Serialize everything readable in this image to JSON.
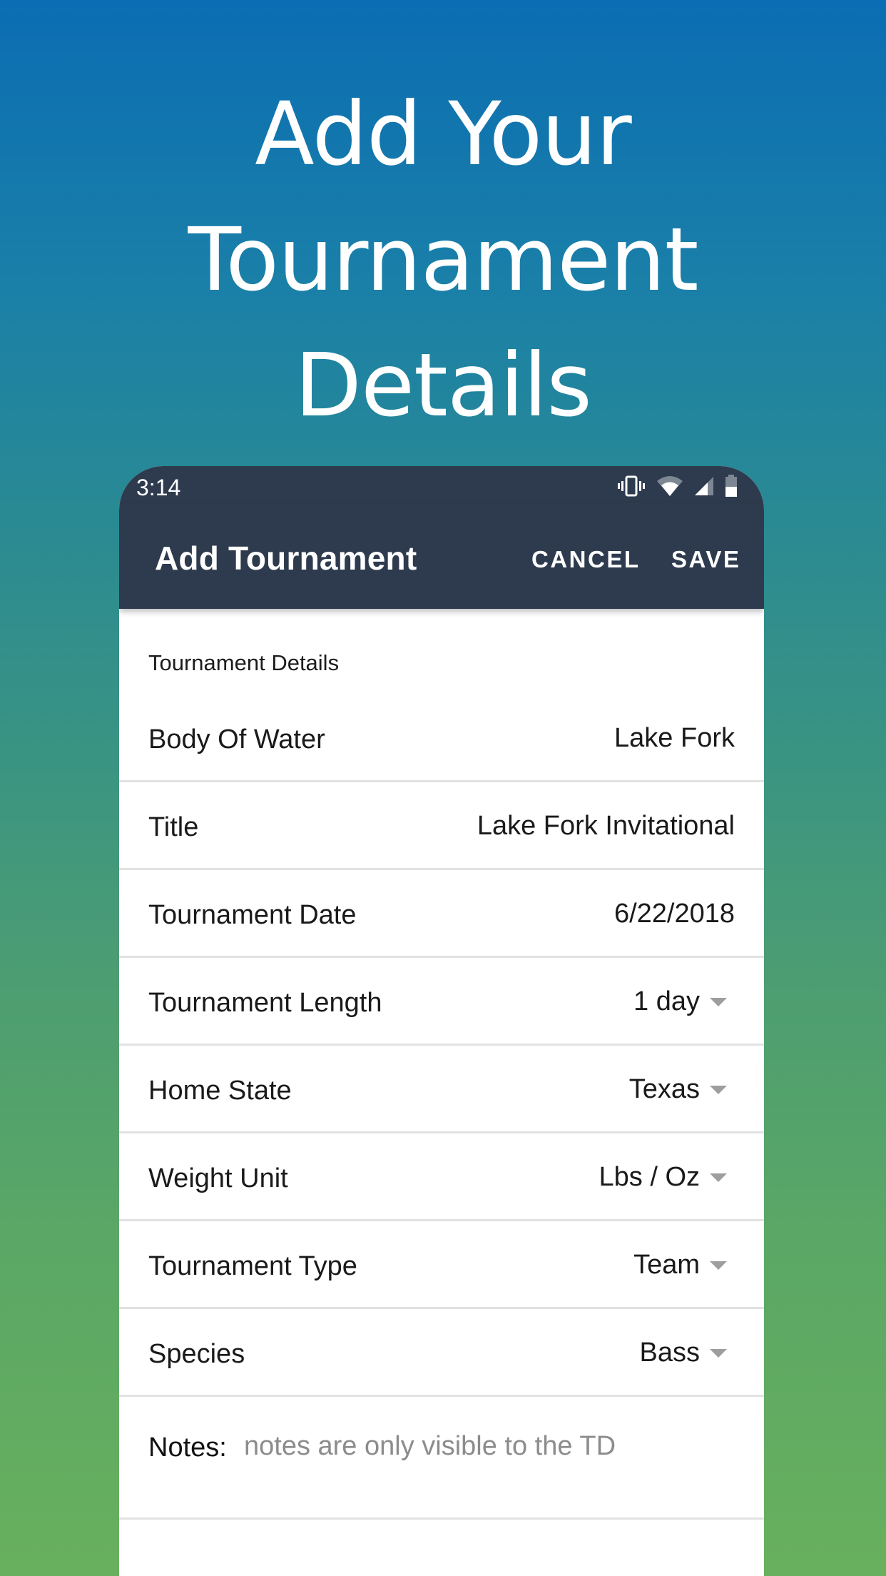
{
  "promo": {
    "headline_lines": [
      "Add Your",
      "Tournament",
      "Details"
    ]
  },
  "status_bar": {
    "time": "3:14",
    "icons": [
      "vibrate-icon",
      "wifi-icon",
      "cell-signal-icon",
      "battery-icon"
    ]
  },
  "app_bar": {
    "title": "Add Tournament",
    "cancel_label": "CANCEL",
    "save_label": "SAVE"
  },
  "form": {
    "section_title": "Tournament Details",
    "fields": [
      {
        "label": "Body Of Water",
        "value": "Lake Fork",
        "dropdown": false
      },
      {
        "label": "Title",
        "value": "Lake Fork Invitational",
        "dropdown": false
      },
      {
        "label": "Tournament Date",
        "value": "6/22/2018",
        "dropdown": false
      },
      {
        "label": "Tournament Length",
        "value": "1 day",
        "dropdown": true
      },
      {
        "label": "Home State",
        "value": "Texas",
        "dropdown": true
      },
      {
        "label": "Weight Unit",
        "value": "Lbs / Oz",
        "dropdown": true
      },
      {
        "label": "Tournament Type",
        "value": "Team",
        "dropdown": true
      },
      {
        "label": "Species",
        "value": "Bass",
        "dropdown": true
      }
    ],
    "notes": {
      "label": "Notes:",
      "value": "",
      "placeholder": "notes are only visible to the TD"
    }
  },
  "colors": {
    "app_bar": "#2e3b4e",
    "gradient_top": "#0b6db3",
    "gradient_bottom": "#68b05e",
    "divider": "#e2e2e2",
    "dropdown_arrow": "#9e9e9e",
    "placeholder": "#8c8c8c"
  }
}
